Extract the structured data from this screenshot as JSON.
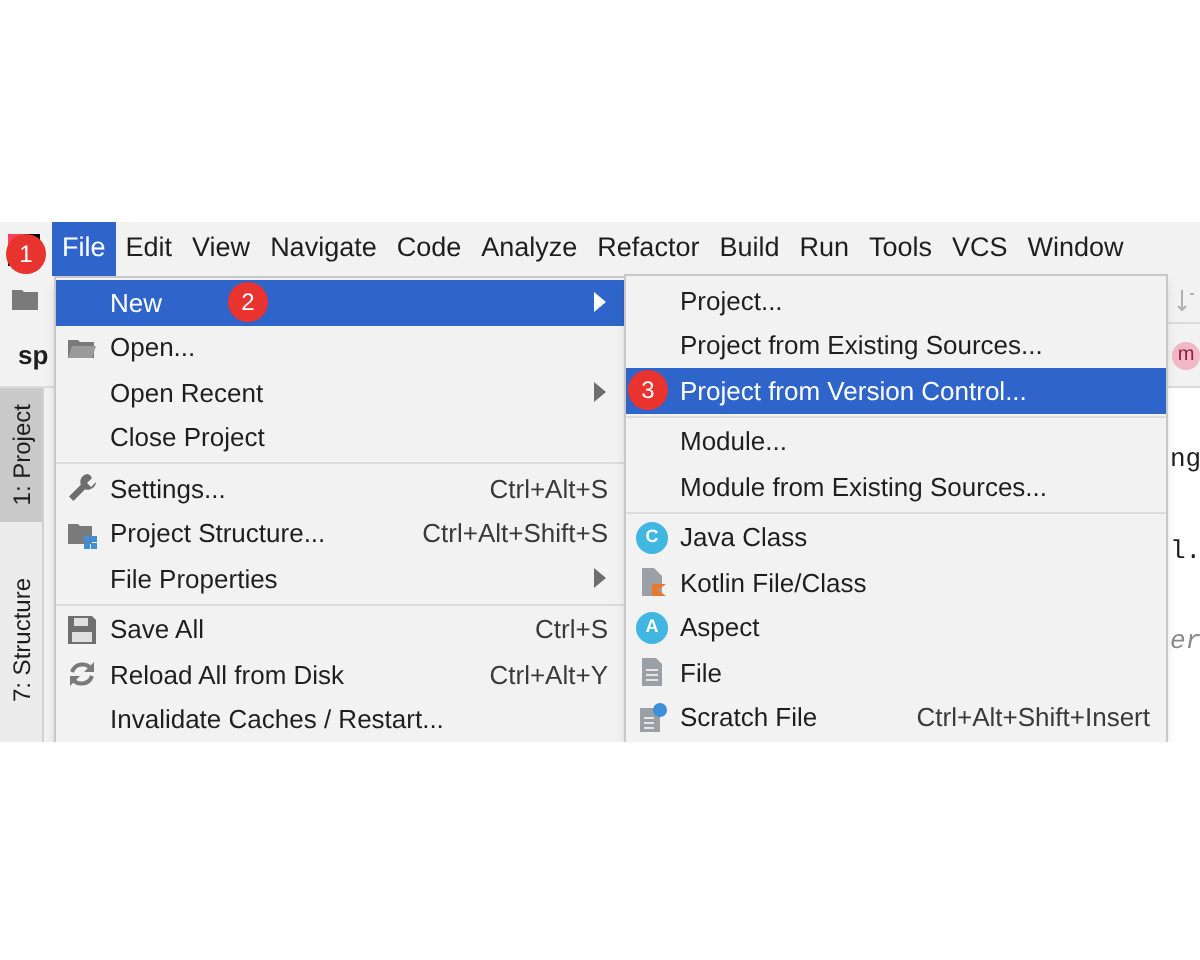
{
  "menubar": {
    "items": [
      {
        "label": "File",
        "selected": true,
        "badge": "1"
      },
      {
        "label": "Edit",
        "selected": false
      },
      {
        "label": "View",
        "selected": false
      },
      {
        "label": "Navigate",
        "selected": false
      },
      {
        "label": "Code",
        "selected": false
      },
      {
        "label": "Analyze",
        "selected": false
      },
      {
        "label": "Refactor",
        "selected": false
      },
      {
        "label": "Build",
        "selected": false
      },
      {
        "label": "Run",
        "selected": false
      },
      {
        "label": "Tools",
        "selected": false
      },
      {
        "label": "VCS",
        "selected": false
      },
      {
        "label": "Window",
        "selected": false
      }
    ]
  },
  "editor_tab": {
    "label": "sp",
    "badge": "m"
  },
  "tool_stripe": [
    {
      "label": "1: Project",
      "selected": true
    },
    {
      "label": "7: Structure",
      "selected": false
    }
  ],
  "editor_lines": [
    "ng",
    "l.",
    "er"
  ],
  "file_menu": {
    "items": [
      {
        "kind": "item",
        "label": "New",
        "submenu": true,
        "selected": true,
        "badge": "2"
      },
      {
        "kind": "item",
        "label": "Open...",
        "submenu": false,
        "selected": false
      },
      {
        "kind": "item",
        "label": "Open Recent",
        "submenu": true,
        "selected": false
      },
      {
        "kind": "item",
        "label": "Close Project",
        "submenu": false,
        "selected": false
      },
      {
        "kind": "separator"
      },
      {
        "kind": "item",
        "label": "Settings...",
        "shortcut": "Ctrl+Alt+S",
        "submenu": false,
        "selected": false
      },
      {
        "kind": "item",
        "label": "Project Structure...",
        "shortcut": "Ctrl+Alt+Shift+S",
        "submenu": false,
        "selected": false
      },
      {
        "kind": "item",
        "label": "File Properties",
        "submenu": true,
        "selected": false
      },
      {
        "kind": "separator"
      },
      {
        "kind": "item",
        "label": "Save All",
        "shortcut": "Ctrl+S",
        "submenu": false,
        "selected": false
      },
      {
        "kind": "item",
        "label": "Reload All from Disk",
        "shortcut": "Ctrl+Alt+Y",
        "submenu": false,
        "selected": false
      },
      {
        "kind": "item",
        "label": "Invalidate Caches / Restart...",
        "submenu": false,
        "selected": false
      }
    ]
  },
  "new_submenu": {
    "items": [
      {
        "kind": "item",
        "label": "Project...",
        "selected": false
      },
      {
        "kind": "item",
        "label": "Project from Existing Sources...",
        "selected": false
      },
      {
        "kind": "item",
        "label": "Project from Version Control...",
        "selected": true,
        "badge": "3"
      },
      {
        "kind": "separator"
      },
      {
        "kind": "item",
        "label": "Module...",
        "selected": false
      },
      {
        "kind": "item",
        "label": "Module from Existing Sources...",
        "selected": false
      },
      {
        "kind": "separator"
      },
      {
        "kind": "item",
        "label": "Java Class",
        "selected": false,
        "icon_letter": "C"
      },
      {
        "kind": "item",
        "label": "Kotlin File/Class",
        "selected": false
      },
      {
        "kind": "item",
        "label": "Aspect",
        "selected": false,
        "icon_letter": "A"
      },
      {
        "kind": "item",
        "label": "File",
        "selected": false
      },
      {
        "kind": "item",
        "label": "Scratch File",
        "shortcut": "Ctrl+Alt+Shift+Insert",
        "selected": false
      }
    ]
  }
}
